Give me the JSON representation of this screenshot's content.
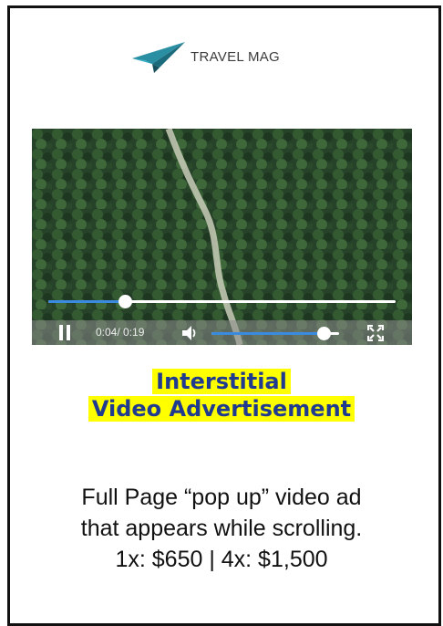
{
  "brand": {
    "name": "TRAVEL MAG"
  },
  "video": {
    "current_time": "0:04",
    "duration": "/ 0:19",
    "progress_fraction": 0.22,
    "volume_fraction": 0.88,
    "accent_color": "#3a8be0"
  },
  "headline": {
    "line1": "Interstitial",
    "line2": "Video Advertisement",
    "highlight_color": "#ffff00",
    "text_color": "#1f3a8f"
  },
  "description": {
    "line1": "Full Page “pop up” video ad",
    "line2": "that appears while scrolling.",
    "line3": "1x: $650 | 4x: $1,500"
  }
}
